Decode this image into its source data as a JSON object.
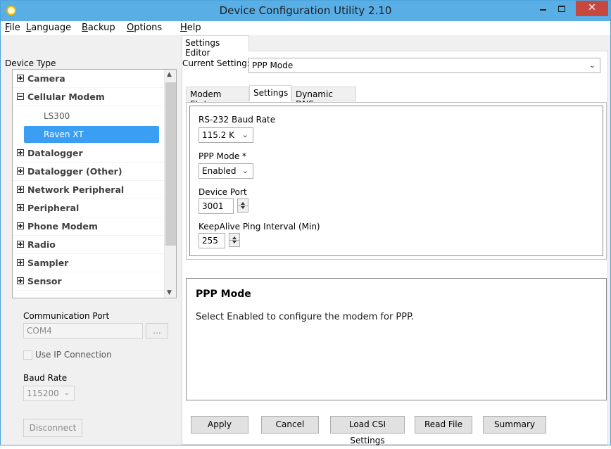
{
  "window": {
    "title": "Device Configuration Utility 2.10",
    "min_glyph": "–",
    "max_glyph": "□",
    "close_glyph": "✕"
  },
  "menu": [
    {
      "pre": "",
      "ul": "F",
      "post": "ile"
    },
    {
      "pre": "",
      "ul": "L",
      "post": "anguage"
    },
    {
      "pre": "",
      "ul": "B",
      "post": "ackup"
    },
    {
      "pre": "",
      "ul": "O",
      "post": "ptions"
    },
    {
      "pre": "",
      "ul": "H",
      "post": "elp"
    }
  ],
  "left": {
    "device_type_label": "Device Type",
    "tree": [
      {
        "label": "Camera",
        "expanded": false
      },
      {
        "label": "Cellular Modem",
        "expanded": true
      },
      {
        "label": "LS300",
        "child": true
      },
      {
        "label": "Raven XT",
        "child": true,
        "selected": true
      },
      {
        "label": "Datalogger",
        "expanded": false
      },
      {
        "label": "Datalogger (Other)",
        "expanded": false
      },
      {
        "label": "Network Peripheral",
        "expanded": false
      },
      {
        "label": "Peripheral",
        "expanded": false
      },
      {
        "label": "Phone Modem",
        "expanded": false
      },
      {
        "label": "Radio",
        "expanded": false
      },
      {
        "label": "Sampler",
        "expanded": false
      },
      {
        "label": "Sensor",
        "expanded": false
      }
    ],
    "comm_port_label": "Communication Port",
    "comm_port_value": "COM4",
    "browse_label": "...",
    "use_ip_label": "Use IP Connection",
    "baud_rate_label": "Baud Rate",
    "baud_rate_value": "115200",
    "disconnect_label": "Disconnect"
  },
  "right": {
    "tab_label": "Settings Editor",
    "current_setting_label": "Current Setting:",
    "current_setting_value": "PPP Mode",
    "subtabs": [
      "Modem Status",
      "Settings",
      "Dynamic DNS"
    ],
    "settings": {
      "baud_label": "RS-232 Baud Rate",
      "baud_value": "115.2 K",
      "ppp_label": "PPP Mode   *",
      "ppp_value": "Enabled",
      "port_label": "Device Port",
      "port_value": "3001",
      "keepalive_label": "KeepAlive Ping Interval (Min)",
      "keepalive_value": "255"
    },
    "help_title": "PPP Mode",
    "help_text": "Select Enabled to configure the modem for PPP.",
    "buttons": [
      "Apply",
      "Cancel",
      "Load CSI Settings",
      "Read File",
      "Summary"
    ]
  }
}
